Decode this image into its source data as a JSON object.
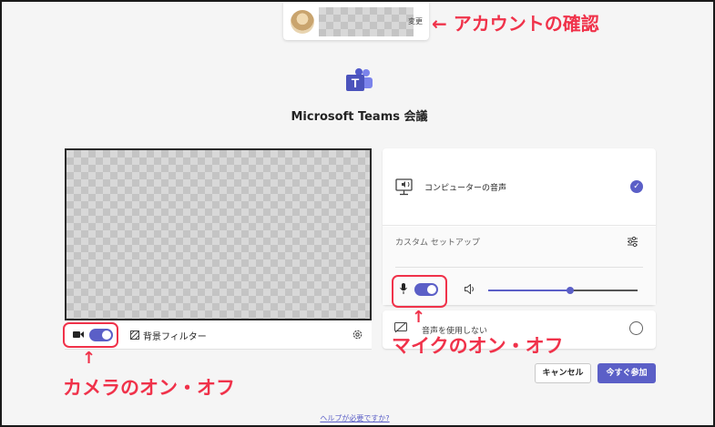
{
  "account": {
    "change_label": "変更",
    "annotation": "← アカウントの確認"
  },
  "meeting": {
    "title": "Microsoft Teams 会議"
  },
  "video": {
    "camera_on": true,
    "filter_label": "背景フィルター",
    "annotation": "カメラのオン・オフ",
    "arrow": "↑"
  },
  "audio": {
    "pc_audio_label": "コンピューターの音声",
    "pc_audio_selected": true,
    "custom_setup_label": "カスタム セットアップ",
    "mic_on": true,
    "volume_level": 0.55,
    "no_audio_label": "音声を使用しない",
    "annotation": "マイクのオン・オフ",
    "arrow": "↑"
  },
  "buttons": {
    "cancel": "キャンセル",
    "join": "今すぐ参加"
  },
  "help_link": "ヘルプが必要ですか?",
  "colors": {
    "accent": "#5b5fc7",
    "annotation": "#f0324a"
  }
}
